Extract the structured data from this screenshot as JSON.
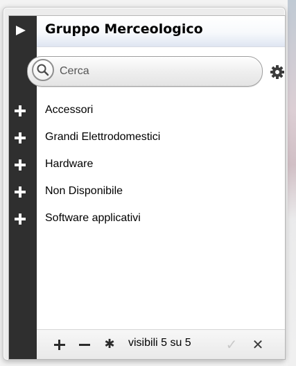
{
  "header": {
    "title": "Gruppo Merceologico"
  },
  "search": {
    "placeholder": "Cerca",
    "value": ""
  },
  "icons": {
    "rail": "play-triangle-icon",
    "search": "magnifier-icon",
    "settings": "gear-icon",
    "expand": "plus-icon",
    "footer_add": "plus-icon",
    "footer_remove": "minus-icon",
    "footer_all": "asterisk-icon",
    "footer_confirm": "check-icon",
    "footer_close": "close-icon"
  },
  "items": [
    {
      "label": "Accessori"
    },
    {
      "label": "Grandi Elettrodomestici"
    },
    {
      "label": "Hardware"
    },
    {
      "label": "Non Disponibile"
    },
    {
      "label": "Software applicativi"
    }
  ],
  "footer": {
    "add_glyph": "+",
    "remove_glyph": "−",
    "all_glyph": "✱",
    "visible_text": "visibili 5 su 5",
    "confirm_glyph": "✓",
    "close_glyph": "✕"
  },
  "colors": {
    "rail": "#2f2f2f",
    "header_gradient_end": "#dfe6f2"
  }
}
